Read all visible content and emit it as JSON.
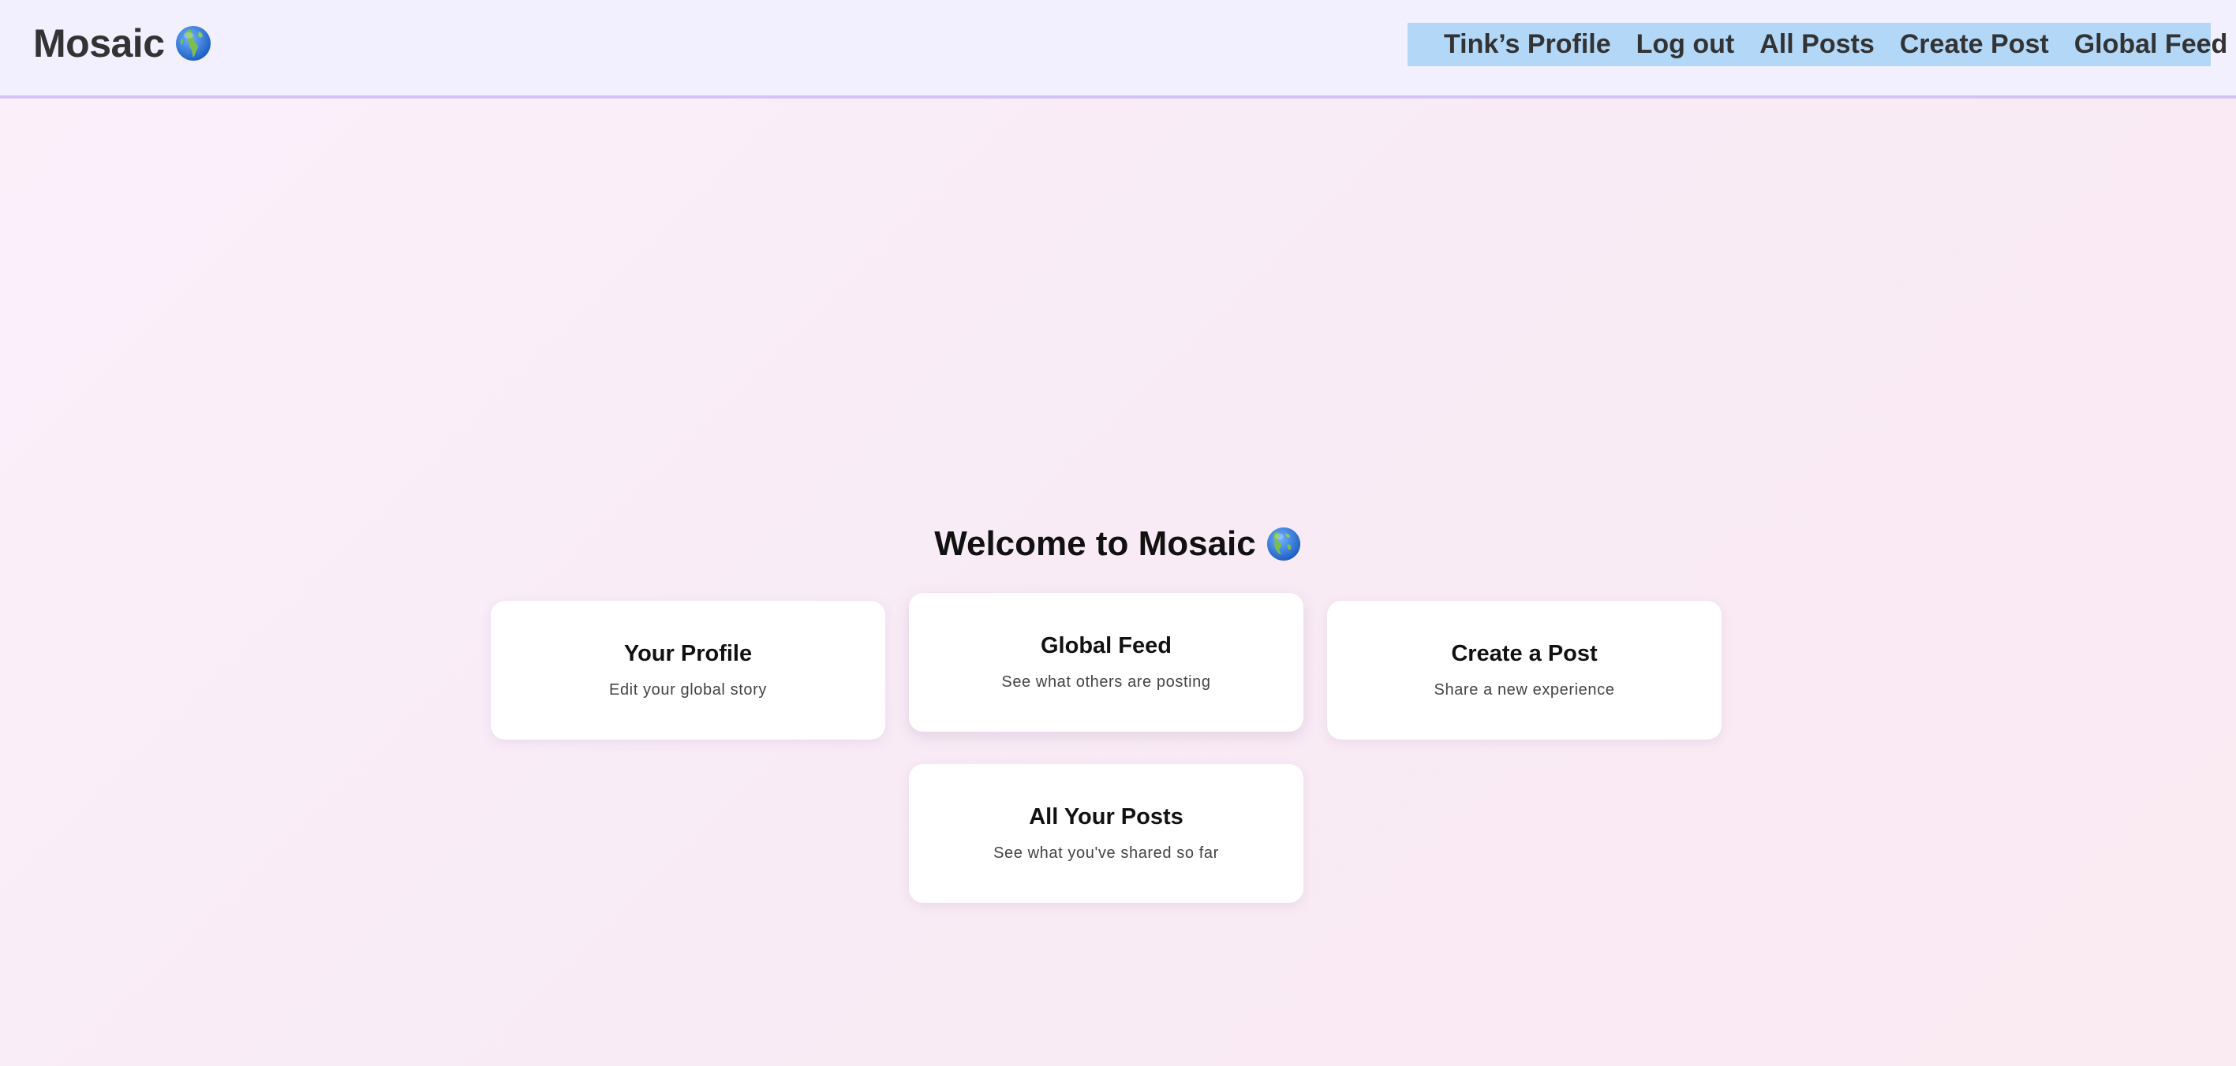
{
  "header": {
    "brand": "Mosaic",
    "brand_icon": "globe-icon",
    "nav": [
      {
        "label": "Tink’s Profile"
      },
      {
        "label": "Log out"
      },
      {
        "label": "All Posts"
      },
      {
        "label": "Create Post"
      },
      {
        "label": "Global Feed"
      }
    ]
  },
  "main": {
    "title": "Welcome to Mosaic",
    "title_icon": "globe-icon",
    "cards": [
      {
        "title": "Your Profile",
        "desc": "Edit your global story"
      },
      {
        "title": "Global Feed",
        "desc": "See what others are posting"
      },
      {
        "title": "Create a Post",
        "desc": "Share a new experience"
      },
      {
        "title": "All Your Posts",
        "desc": "See what you've shared so far"
      }
    ]
  },
  "colors": {
    "topbar_bg": "#f2f0fe",
    "topbar_border": "#d3c4f3",
    "nav_bg": "#b2d7f7",
    "page_bg": "#f9edf6",
    "card_bg": "#ffffff"
  }
}
